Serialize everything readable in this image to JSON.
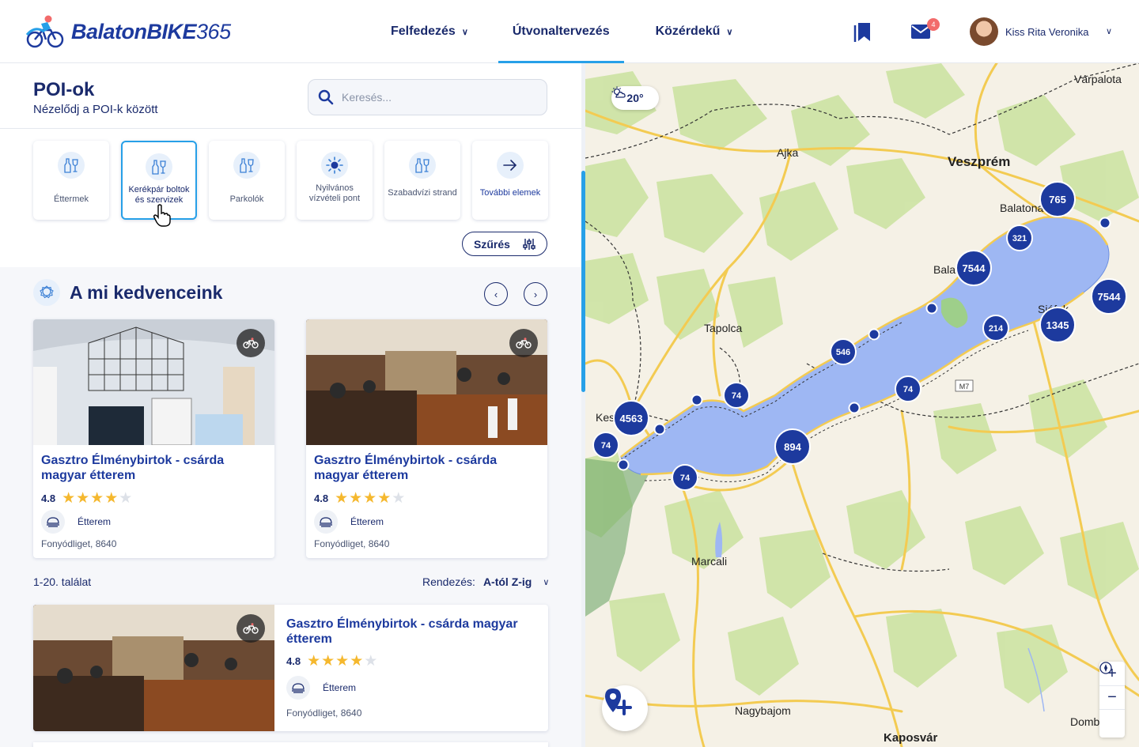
{
  "header": {
    "logo": {
      "name": "BalatonBIKE",
      "suffix": "365"
    },
    "nav": [
      {
        "label": "Felfedezés",
        "has_dropdown": true,
        "active": false
      },
      {
        "label": "Útvonaltervezés",
        "has_dropdown": false,
        "active": true
      },
      {
        "label": "Közérdekű",
        "has_dropdown": true,
        "active": false
      }
    ],
    "icons": {
      "bookmarks": "bookmark-icon",
      "messages": "mail-icon"
    },
    "message_count": "4",
    "user_name": "Kiss Rita Veronika"
  },
  "panel": {
    "title": "POI-ok",
    "subtitle": "Nézelődj a POI-k között",
    "search_placeholder": "Keresés...",
    "categories": [
      {
        "label": "Éttermek",
        "icon": "bottle-glass-icon",
        "selected": false
      },
      {
        "label": "Kerékpár boltok és szervizek",
        "icon": "bottle-glass-icon",
        "selected": true
      },
      {
        "label": "Parkolók",
        "icon": "bottle-glass-icon",
        "selected": false
      },
      {
        "label": "Nyilvános vízvételi pont",
        "icon": "sun-icon",
        "selected": false
      },
      {
        "label": "Szabadvízi strand",
        "icon": "bottle-glass-icon",
        "selected": false
      },
      {
        "label": "További elemek",
        "icon": "arrow-right-icon",
        "selected": false
      }
    ],
    "filter_label": "Szűrés",
    "favorites": {
      "title": "A mi kedvenceink",
      "cards": [
        {
          "name": "Gasztro Élménybirtok - csárda magyar étterem",
          "rating": "4.8",
          "stars": 4,
          "type": "Étterem",
          "address": "Fonyódliget, 8640"
        },
        {
          "name": "Gasztro Élménybirtok - csárda magyar étterem",
          "rating": "4.8",
          "stars": 4,
          "type": "Étterem",
          "address": "Fonyódliget, 8640"
        }
      ]
    },
    "results_label": "1-20. találat",
    "sort_label": "Rendezés:",
    "sort_value": "A-tól Z-ig",
    "list": [
      {
        "name": "Gasztro Élménybirtok - csárda magyar étterem",
        "rating": "4.8",
        "stars": 4,
        "type": "Étterem",
        "address": "Fonyódliget, 8640"
      }
    ]
  },
  "map": {
    "weather": "20°",
    "road_label": "M7",
    "towns": [
      "Várpalota",
      "Ajka",
      "Veszprém",
      "Balatonalmádi",
      "Balatonfüred",
      "Tapolca",
      "Siófok",
      "Keszthely",
      "Marcali",
      "Nagybajom",
      "Kaposvár",
      "Dombóvár"
    ],
    "town_labels": {
      "varpalota": "Várpalota",
      "ajka": "Ajka",
      "veszprem": "Veszprém",
      "balatonalmadi": "Balatona",
      "balatonfured": "Balat",
      "balatonfured2": "d",
      "tapolca": "Tapolca",
      "siofok": "Siófok",
      "keszthely": "Kes",
      "marcali": "Marcali",
      "nagybajom": "Nagybajom",
      "kaposvar": "Kaposvár",
      "dombovar": "Domb"
    },
    "clusters": [
      "765",
      "321",
      "7544",
      "7544",
      "1345",
      "214",
      "546",
      "74",
      "74",
      "4563",
      "74",
      "894",
      "74"
    ],
    "zoom_in": "+",
    "zoom_out": "−"
  }
}
